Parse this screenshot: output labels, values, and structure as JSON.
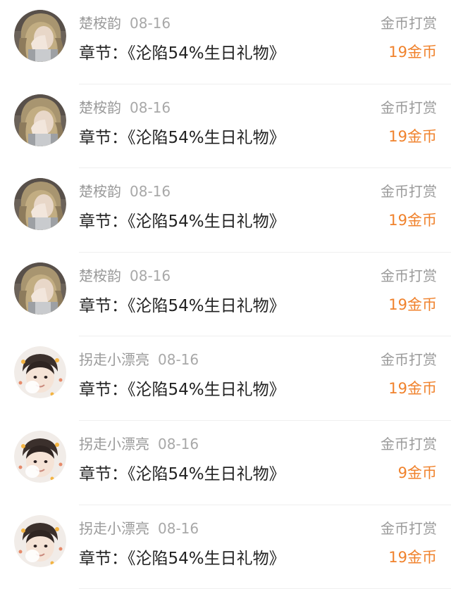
{
  "colors": {
    "amount": "#f0822c",
    "meta_text": "#9a9a9a",
    "title_text": "#222222",
    "divider": "#efefef"
  },
  "records": [
    {
      "avatar": "user-avatar-blonde",
      "user": "楚桉韵",
      "date": "08-16",
      "type": "金币打赏",
      "chapter": "章节：《沦陷54%生日礼物》",
      "amount": "19金币"
    },
    {
      "avatar": "user-avatar-blonde",
      "user": "楚桉韵",
      "date": "08-16",
      "type": "金币打赏",
      "chapter": "章节：《沦陷54%生日礼物》",
      "amount": "19金币"
    },
    {
      "avatar": "user-avatar-blonde",
      "user": "楚桉韵",
      "date": "08-16",
      "type": "金币打赏",
      "chapter": "章节：《沦陷54%生日礼物》",
      "amount": "19金币"
    },
    {
      "avatar": "user-avatar-blonde",
      "user": "楚桉韵",
      "date": "08-16",
      "type": "金币打赏",
      "chapter": "章节：《沦陷54%生日礼物》",
      "amount": "19金币"
    },
    {
      "avatar": "user-avatar-dark",
      "user": "拐走小漂亮",
      "date": "08-16",
      "type": "金币打赏",
      "chapter": "章节：《沦陷54%生日礼物》",
      "amount": "19金币"
    },
    {
      "avatar": "user-avatar-dark",
      "user": "拐走小漂亮",
      "date": "08-16",
      "type": "金币打赏",
      "chapter": "章节：《沦陷54%生日礼物》",
      "amount": "9金币"
    },
    {
      "avatar": "user-avatar-dark",
      "user": "拐走小漂亮",
      "date": "08-16",
      "type": "金币打赏",
      "chapter": "章节：《沦陷54%生日礼物》",
      "amount": "19金币"
    }
  ]
}
